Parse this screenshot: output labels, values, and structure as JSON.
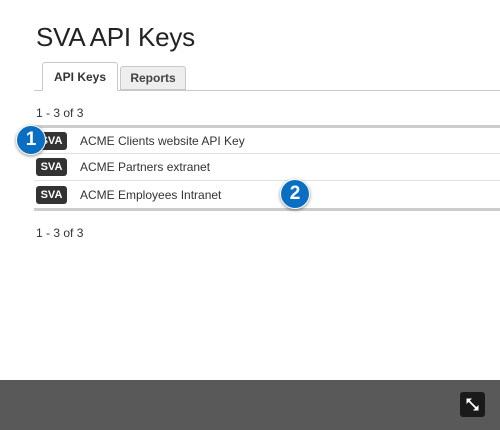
{
  "page": {
    "title": "SVA API Keys"
  },
  "tabs": [
    {
      "label": "API Keys",
      "active": true
    },
    {
      "label": "Reports",
      "active": false
    }
  ],
  "pagination": {
    "top": "1 - 3 of 3",
    "bottom": "1 - 3 of 3"
  },
  "api_keys": [
    {
      "badge": "SVA",
      "name": "ACME Clients website API Key"
    },
    {
      "badge": "SVA",
      "name": "ACME Partners extranet"
    },
    {
      "badge": "SVA",
      "name": "ACME Employees Intranet"
    }
  ],
  "markers": [
    {
      "number": "1"
    },
    {
      "number": "2"
    }
  ],
  "footer": {
    "expand_icon": "expand-icon"
  },
  "colors": {
    "badge_bg": "#333333",
    "marker_bg": "#0a6fc2",
    "footer_bg": "#595959"
  }
}
